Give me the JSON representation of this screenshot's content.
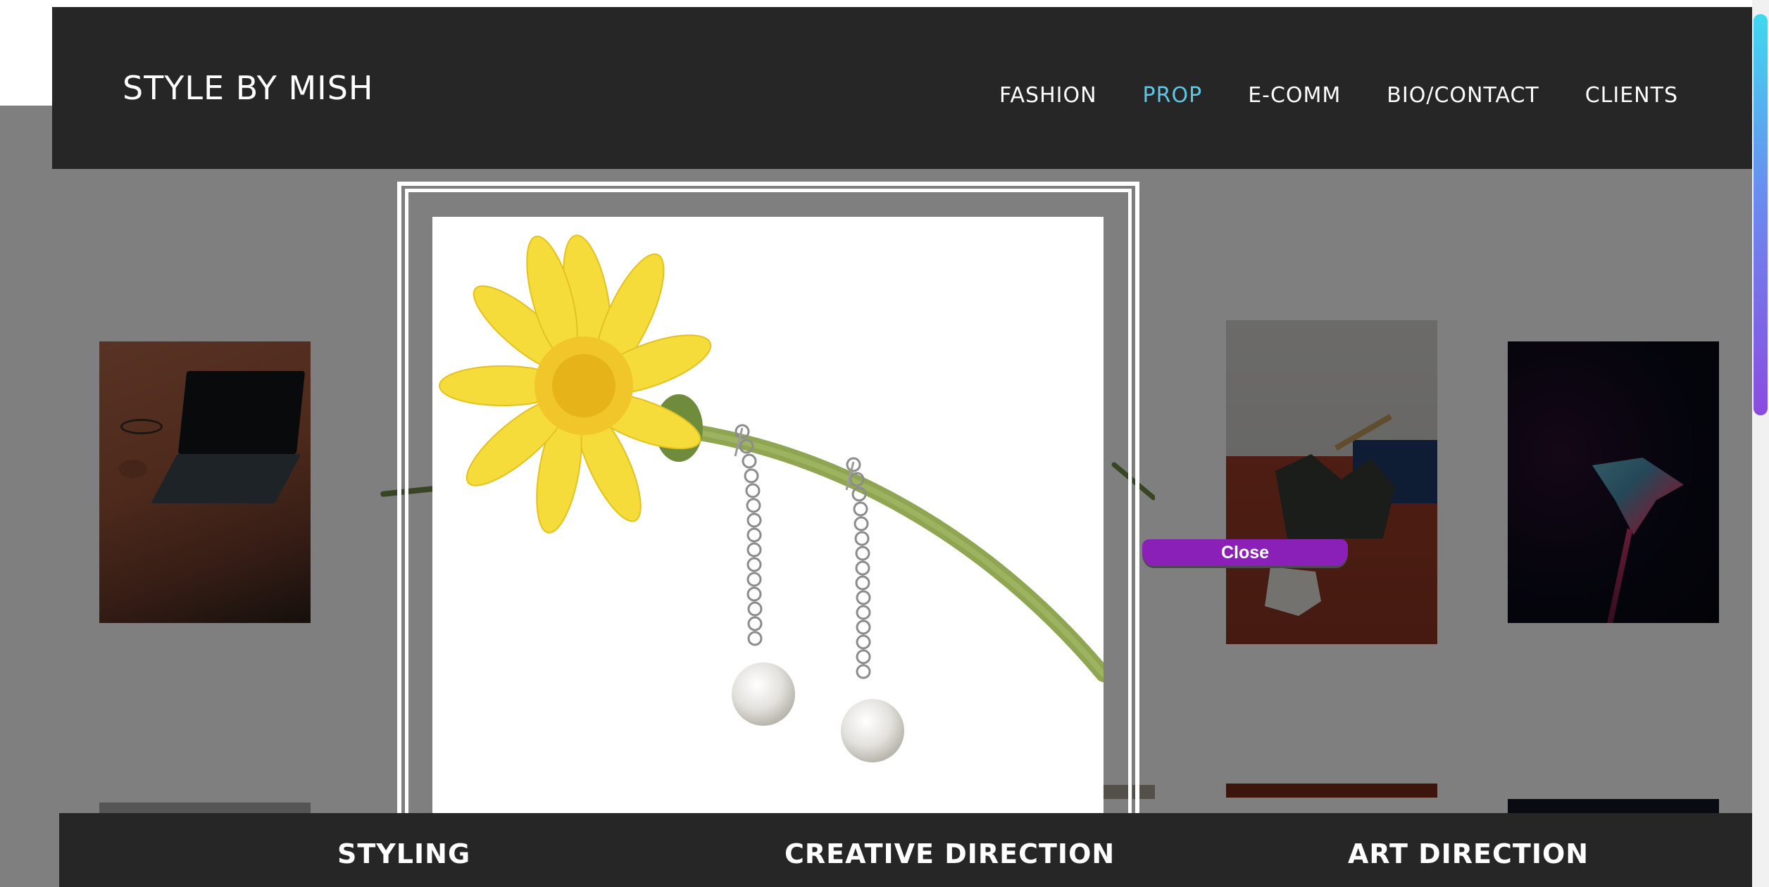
{
  "header": {
    "brand": "STYLE BY MISH",
    "nav": [
      "FASHION",
      "PROP",
      "E-COMM",
      "BIO/CONTACT",
      "CLIENTS"
    ],
    "active_nav": "PROP",
    "active_color": "#5fc7e6"
  },
  "lightbox": {
    "close_label": "Close",
    "close_color": "#8a20b8"
  },
  "footer": {
    "items": [
      "STYLING",
      "CREATIVE DIRECTION",
      "ART DIRECTION"
    ]
  },
  "colors": {
    "header_bg": "#262626",
    "scrollbar_gradient": [
      "#3fd9f0",
      "#8a4ce0"
    ]
  }
}
